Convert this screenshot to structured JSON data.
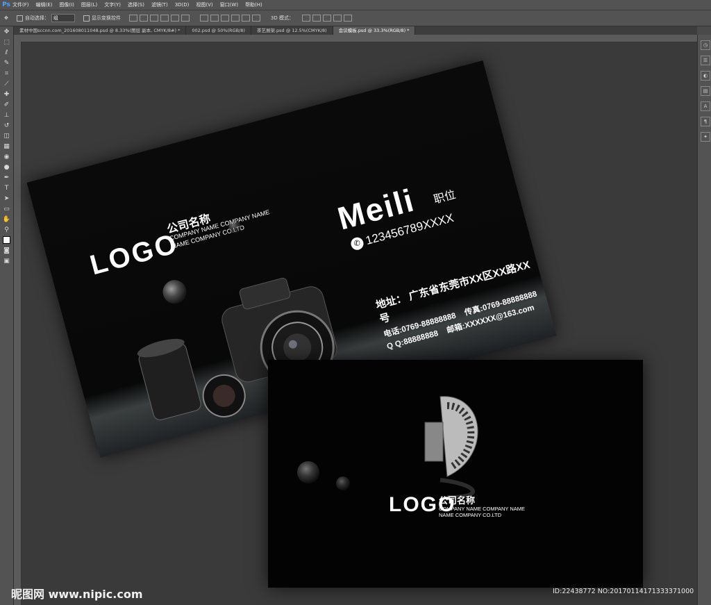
{
  "menubar": {
    "app_icon": "Ps",
    "items": [
      "文件(F)",
      "编辑(E)",
      "图像(I)",
      "图层(L)",
      "文字(Y)",
      "选择(S)",
      "滤镜(T)",
      "3D(D)",
      "视图(V)",
      "窗口(W)",
      "帮助(H)"
    ]
  },
  "options": {
    "auto_select_label": "自动选择：",
    "auto_select_value": "组",
    "show_transform_label": "显示变换控件",
    "mode3d_label": "3D 模式："
  },
  "tabs": [
    "素材中国sccnn.com_20160801104​8.psd @ 8.33%(图层 副本, CMYK/8#) *",
    "002.psd @ 50%(RGB/8)",
    "茶艺展架.psd @ 12.5%(CMYK/8)",
    "会议模板.psd @ 33.3%(RGB/8) *"
  ],
  "front_card": {
    "logo": "LOGO",
    "company_cn": "公司名称",
    "company_en1": "COMPANY NAME COMPANY NAME",
    "company_en2": "NAME COMPANY CO.LTD",
    "name": "Meili",
    "position": "职位",
    "phone": "123456789XXXX",
    "address": "地址：  广东省东莞市XX区XX路XX号",
    "tel": "电话:0769-88888888",
    "fax": "传真:0769-88888888",
    "qq": "Q Q:88888888",
    "email": "邮箱:XXXXXX@163.com"
  },
  "back_card": {
    "logo": "LOGO",
    "company_cn": "公司名称",
    "company_en1": "COMPANY NAME COMPANY NAME",
    "company_en2": "NAME COMPANY CO.LTD"
  },
  "watermark": "昵图网 www.nipic.com",
  "id_text": "ID:22438772 NO:20170114171333371000",
  "tool_icons": [
    "move-icon",
    "marquee-icon",
    "lasso-icon",
    "quick-select-icon",
    "crop-icon",
    "eyedropper-icon",
    "healing-icon",
    "brush-icon",
    "stamp-icon",
    "history-brush-icon",
    "eraser-icon",
    "gradient-icon",
    "blur-icon",
    "dodge-icon",
    "pen-icon",
    "type-icon",
    "path-select-icon",
    "shape-icon",
    "hand-icon",
    "zoom-icon"
  ]
}
